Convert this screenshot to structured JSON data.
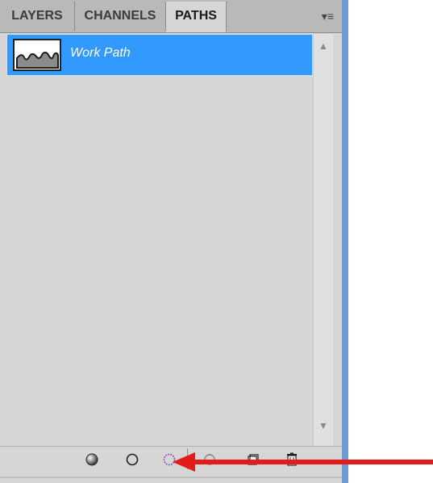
{
  "tabs": [
    {
      "label": "LAYERS"
    },
    {
      "label": "CHANNELS"
    },
    {
      "label": "PATHS"
    }
  ],
  "panel": {
    "menu_icon": "panel-menu-icon"
  },
  "paths": [
    {
      "name": "Work Path"
    }
  ],
  "footer_buttons": [
    {
      "name": "fill-path-icon"
    },
    {
      "name": "stroke-path-icon"
    },
    {
      "name": "load-selection-icon"
    },
    {
      "name": "make-work-path-icon"
    },
    {
      "name": "new-path-icon"
    },
    {
      "name": "trash-icon"
    }
  ],
  "colors": {
    "selection": "#3299ff",
    "arrow": "#e31b1b",
    "panel": "#d6d6d6"
  }
}
